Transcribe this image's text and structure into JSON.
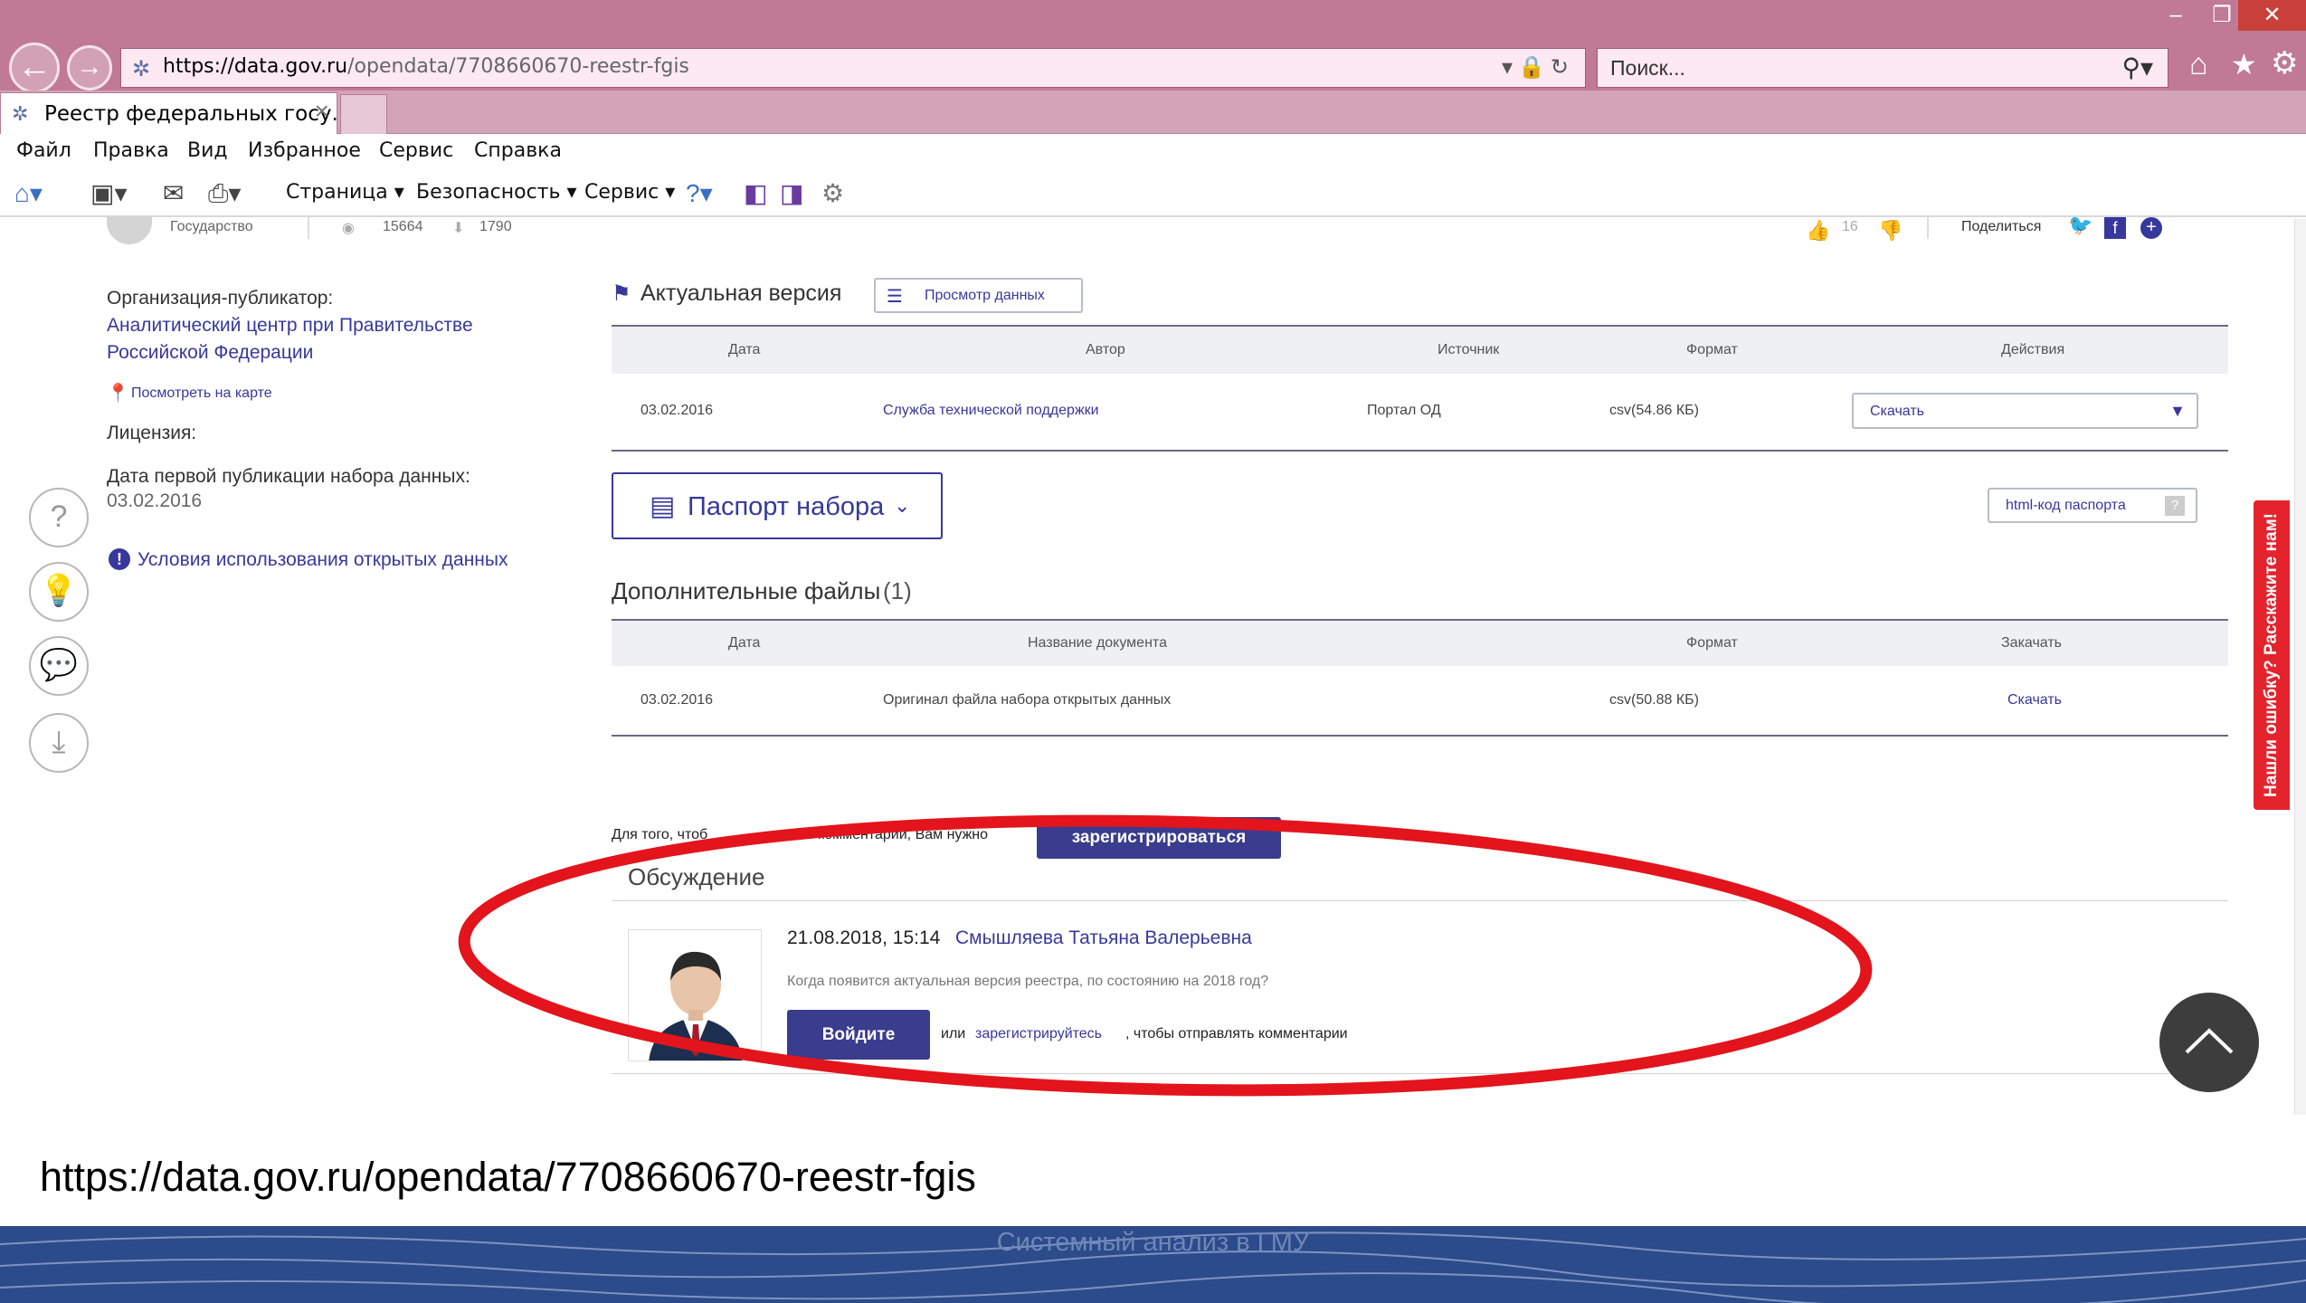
{
  "browser": {
    "url_host": "https://data.gov.ru",
    "url_path": "/opendata/7708660670-reestr-fgis",
    "search_placeholder": "Поиск...",
    "tab_title": "Реестр федеральных госу...",
    "menu": [
      "Файл",
      "Правка",
      "Вид",
      "Избранное",
      "Сервис",
      "Справка"
    ],
    "commands": [
      "Страница ▾",
      "Безопасность ▾",
      "Сервис ▾"
    ]
  },
  "topinfo": {
    "label": "Государство",
    "views": "15664",
    "downloads": "1790",
    "likes": "16",
    "share": "Поделиться"
  },
  "sidebar": {
    "org_label": "Организация-публикатор:",
    "org_name_1": "Аналитический центр при Правительстве",
    "org_name_2": "Российской Федерации",
    "map_link": "Посмотреть на карте",
    "license_label": "Лицензия:",
    "first_pub_label": "Дата первой публикации набора данных:",
    "first_pub_date": "03.02.2016",
    "terms_link": "Условия использования открытых данных"
  },
  "current_version": {
    "heading": "Актуальная версия",
    "view_button": "Просмотр данных",
    "columns": [
      "Дата",
      "Автор",
      "Источник",
      "Формат",
      "Действия"
    ],
    "row": {
      "date": "03.02.2016",
      "author": "Служба технической поддержки",
      "source": "Портал ОД",
      "format": "csv(54.86 КБ)",
      "action": "Скачать"
    }
  },
  "passport": {
    "button": "Паспорт набора",
    "html_code": "html-код паспорта"
  },
  "extra_files": {
    "heading": "Дополнительные файлы",
    "count": "(1)",
    "columns": [
      "Дата",
      "Название документа",
      "Формат",
      "Закачать"
    ],
    "row": {
      "date": "03.02.2016",
      "name": "Оригинал файла набора открытых данных",
      "format": "csv(50.88 КБ)",
      "action": "Скачать"
    }
  },
  "discussion": {
    "register_prompt_start": "Для того, чтоб",
    "register_prompt_end": "ить комментарий, Вам нужно",
    "register_button": "зарегистрироваться",
    "heading": "Обсуждение",
    "comment_datetime": "21.08.2018, 15:14",
    "comment_author": "Смышляева Татьяна Валерьевна",
    "comment_text": "Когда появится актуальная версия реестра, по состоянию на 2018 год?",
    "login_button": "Войдите",
    "login_or": "или",
    "login_register_link": "зарегистрируйтесь",
    "login_tail": ", чтобы отправлять комментарии"
  },
  "feedback_tab": "Нашли ошибку? Расскажите нам!",
  "slide": {
    "caption_url": "https://data.gov.ru/opendata/7708660670-reestr-fgis",
    "footer_title": "Системный анализ в ГМУ"
  },
  "colors": {
    "accent": "#3a3c8e",
    "highlight_ellipse": "#e3141b",
    "footer": "#2b4b8a",
    "chrome": "#c07a95"
  }
}
